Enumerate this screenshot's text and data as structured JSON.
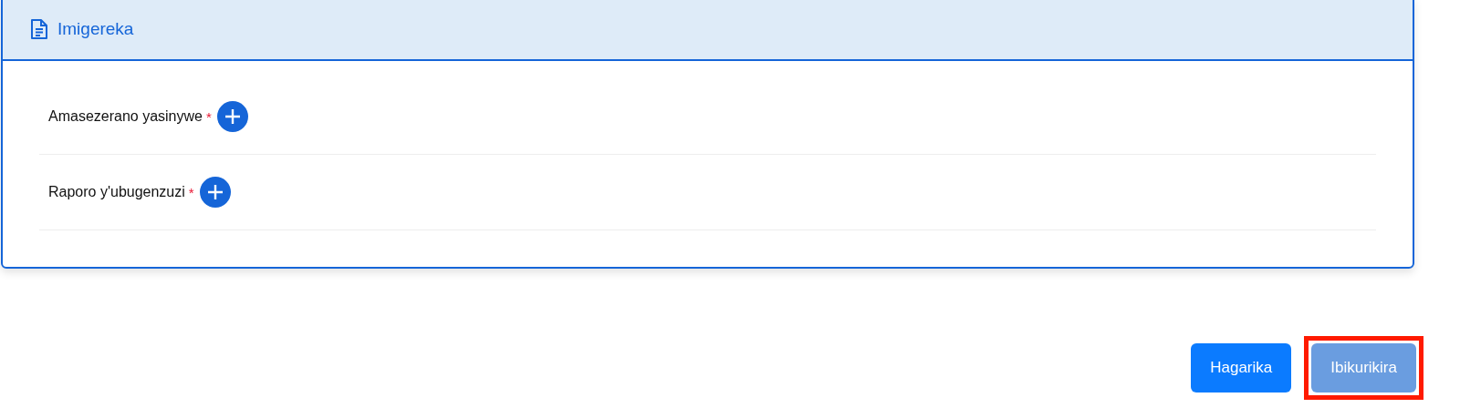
{
  "panel": {
    "title": "Imigereka",
    "items": [
      {
        "label": "Amasezerano yasinywe",
        "required": true
      },
      {
        "label": "Raporo y'ubugenzuzi",
        "required": true
      }
    ]
  },
  "required_mark": "*",
  "buttons": [
    {
      "label": "Hagarika",
      "disabled": false,
      "highlighted": false
    },
    {
      "label": "Ibikurikira",
      "disabled": true,
      "highlighted": true
    }
  ]
}
